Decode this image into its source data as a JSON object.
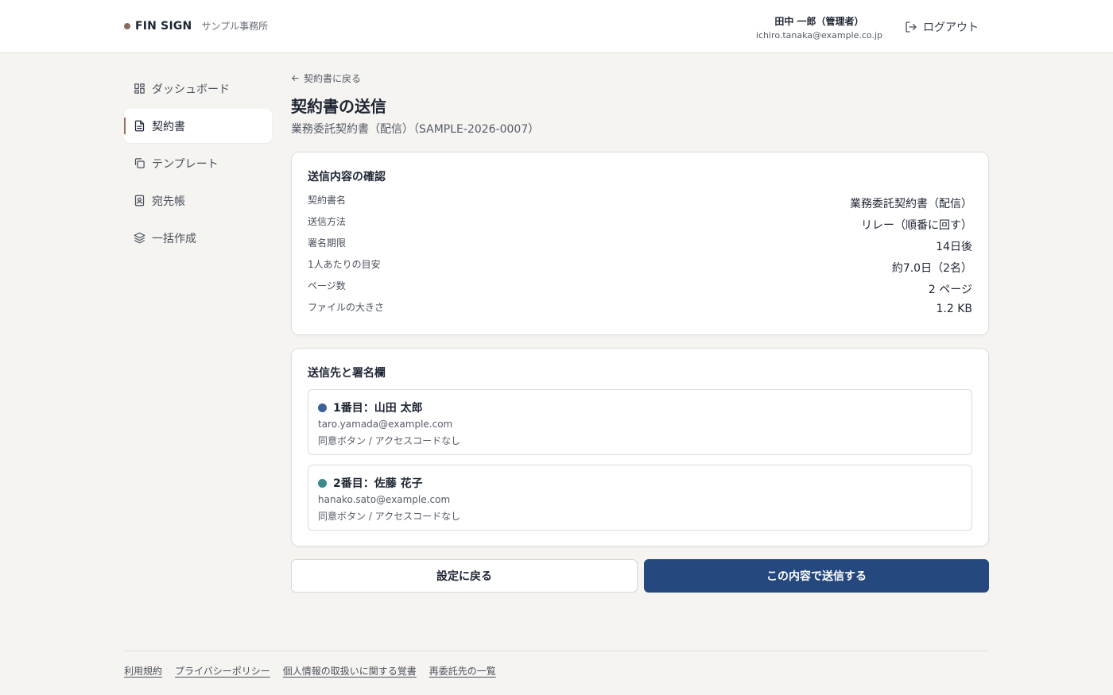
{
  "header": {
    "brand_name": "FIN SIGN",
    "org_name": "サンプル事務所",
    "user_name": "田中 一郎（管理者）",
    "user_email": "ichiro.tanaka@example.co.jp",
    "logout_label": "ログアウト",
    "logout_icon": "logout-icon"
  },
  "sidebar": {
    "items": [
      {
        "label": "ダッシュボード",
        "icon": "dashboard-icon",
        "active": false
      },
      {
        "label": "契約書",
        "icon": "document-icon",
        "active": true
      },
      {
        "label": "テンプレート",
        "icon": "copy-icon",
        "active": false
      },
      {
        "label": "宛先帳",
        "icon": "contact-book-icon",
        "active": false
      },
      {
        "label": "一括作成",
        "icon": "layers-icon",
        "active": false
      }
    ]
  },
  "main": {
    "back_label": "契約書に戻る",
    "title": "契約書の送信",
    "subtitle": "業務委託契約書（配信）（SAMPLE-2026-0007）",
    "summary": {
      "title": "送信内容の確認",
      "rows": [
        {
          "label": "契約書名",
          "value": "業務委託契約書（配信）"
        },
        {
          "label": "送信方法",
          "value": "リレー（順番に回す）"
        },
        {
          "label": "署名期限",
          "value": "14日後"
        },
        {
          "label": "1人あたりの目安",
          "value": "約7.0日（2名）"
        },
        {
          "label": "ページ数",
          "value": "2 ページ"
        },
        {
          "label": "ファイルの大きさ",
          "value": "1.2 KB"
        }
      ]
    },
    "recipients": {
      "title": "送信先と署名欄",
      "items": [
        {
          "name": "1番目：山田 太郎",
          "email": "taro.yamada@example.com",
          "method": "同意ボタン / アクセスコードなし",
          "color": "#3d5f9e"
        },
        {
          "name": "2番目：佐藤 花子",
          "email": "hanako.sato@example.com",
          "method": "同意ボタン / アクセスコードなし",
          "color": "#3b8a8c"
        }
      ]
    },
    "buttons": {
      "back_to_settings": "設定に戻る",
      "send": "この内容で送信する"
    }
  },
  "footer": {
    "links": [
      "利用規約",
      "プライバシーポリシー",
      "個人情報の取扱いに関する覚書",
      "再委託先の一覧"
    ]
  },
  "colors": {
    "accent": "#25487e",
    "active_marker": "#9a6f5e",
    "background": "#f5f4f1"
  }
}
